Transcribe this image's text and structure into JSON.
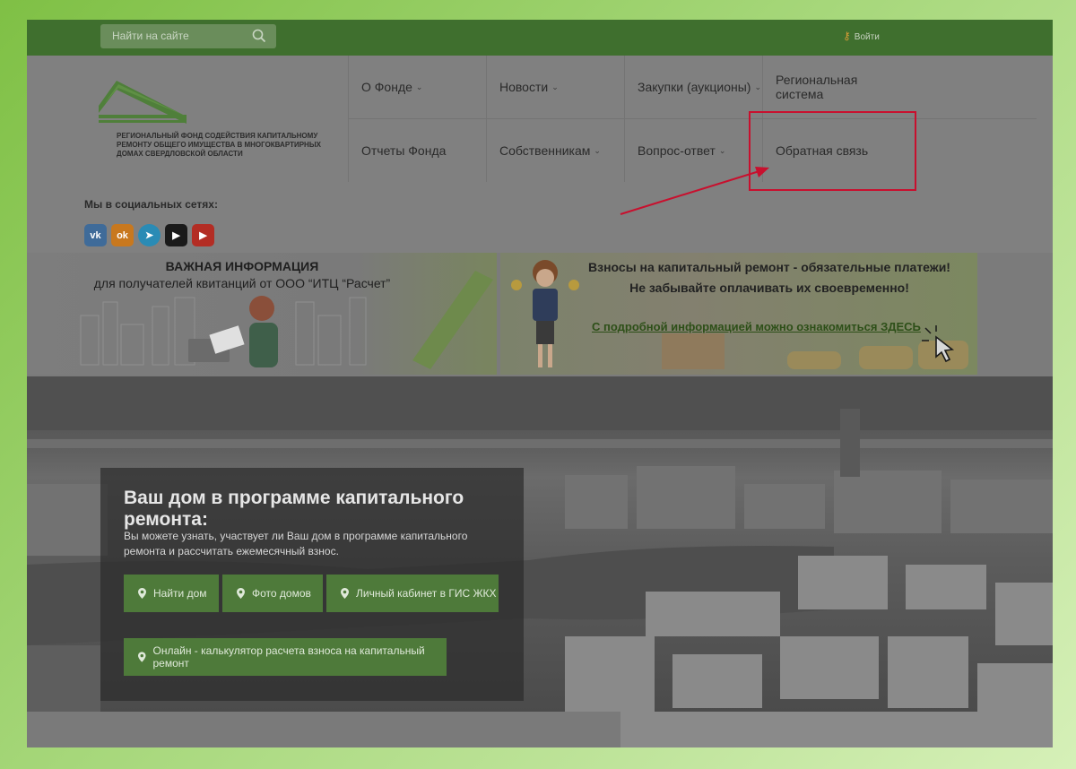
{
  "topbar": {
    "search_placeholder": "Найти на сайте",
    "login_label": "Войти"
  },
  "logo": {
    "text": "Региональный фонд содействия капитальному ремонту общего имущества в многоквартирных домах Свердловской области"
  },
  "nav": [
    {
      "label": "О Фонде",
      "dropdown": true
    },
    {
      "label": "Новости",
      "dropdown": true
    },
    {
      "label": "Закупки (аукционы)",
      "dropdown": true
    },
    {
      "label": "Региональная система",
      "dropdown": false
    },
    {
      "label": "Отчеты Фонда",
      "dropdown": false
    },
    {
      "label": "Собственникам",
      "dropdown": true
    },
    {
      "label": "Вопрос-ответ",
      "dropdown": true
    },
    {
      "label": "Обратная связь",
      "dropdown": false
    }
  ],
  "social": {
    "title": "Мы в социальных сетях:",
    "icons": [
      "vk-icon",
      "odnoklassniki-icon",
      "telegram-icon",
      "tiktok-icon",
      "youtube-icon"
    ]
  },
  "banner_left": {
    "title": "ВАЖНАЯ ИНФОРМАЦИЯ",
    "subtitle": "для получателей квитанций от ООО “ИТЦ “Расчет”"
  },
  "banner_right": {
    "line1": "Взносы на капитальный ремонт - обязательные платежи!",
    "line2": "Не забывайте оплачивать их своевременно!",
    "link": "С подробной информацией можно ознакомиться ЗДЕСЬ"
  },
  "hero": {
    "title": "Ваш дом в программе капитального ремонта:",
    "text": "Вы можете узнать, участвует ли Ваш дом в программе капитального ремонта и рассчитать ежемесячный взнос.",
    "buttons": [
      "Найти дом",
      "Фото домов",
      "Личный кабинет в ГИС ЖКХ",
      "Онлайн - калькулятор расчета взноса на капитальный ремонт"
    ]
  },
  "colors": {
    "accent": "#4e7a3a",
    "topbar": "#3f6f2e",
    "highlight": "#c8102e"
  }
}
